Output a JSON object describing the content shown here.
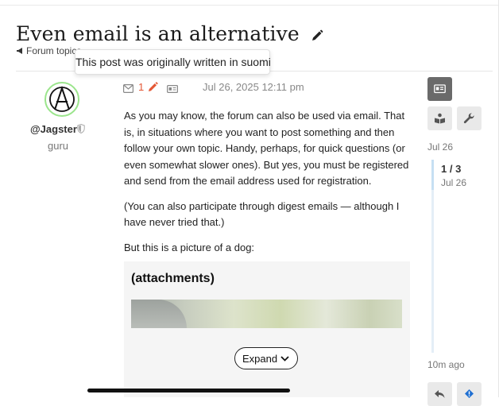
{
  "topic": {
    "title": "Even email is an alternative",
    "category": "Forum topics",
    "tooltip": "This post was originally written in suomi"
  },
  "post": {
    "username": "@Jagster",
    "user_title": "guru",
    "reply_count": "1",
    "date": "Jul 26, 2025 12:11 pm",
    "paragraphs": [
      "As you may know, the forum can also be used via email. That is, in situations where you want to post something and then follow your own topic. Handy, perhaps, for quick questions (or even somewhat slower ones). But yes, you must be registered and send from the email address used for registration.",
      "(You can also participate through digest emails — although I have never tried that.)",
      "But this is a picture of a dog:"
    ],
    "attachments_title": "(attachments)",
    "expand_label": "Expand"
  },
  "sidebar": {
    "icons": [
      "id-card-icon",
      "book-reader-icon",
      "wrench-icon",
      "reply-icon",
      "flag-icon"
    ]
  },
  "timeline": {
    "start_date": "Jul 26",
    "position": "1 / 3",
    "position_date": "Jul 26",
    "last_activity": "10m ago"
  },
  "colors": {
    "accent": "#e45735",
    "avatar_ring": "#9be58c",
    "timeline_fill": "#c6dff3"
  }
}
